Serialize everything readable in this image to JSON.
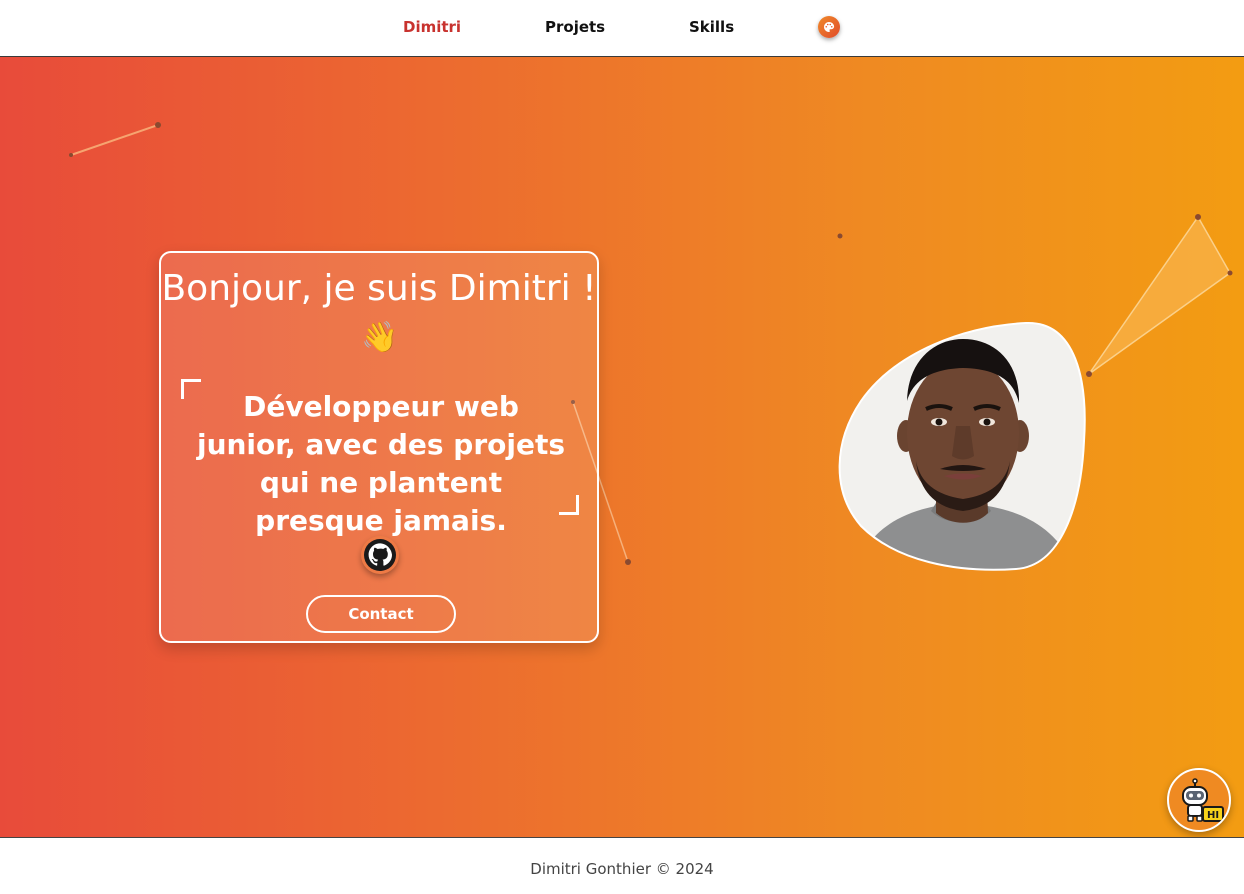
{
  "nav": {
    "home_label": "Dimitri",
    "projects_label": "Projets",
    "skills_label": "Skills",
    "theme_icon": "palette-icon",
    "active_color": "#c8322e"
  },
  "hero": {
    "greeting": "Bonjour, je suis Dimitri !",
    "wave_emoji": "👋",
    "tagline": "Développeur web junior, avec des projets qui ne plantent presque jamais.",
    "github_icon": "github-icon",
    "contact_label": "Contact",
    "photo_alt": "Dimitri",
    "chatbot_badge": "HI",
    "gradient_start": "#e84b3a",
    "gradient_end": "#f39c12"
  },
  "footer": {
    "copyright": "Dimitri Gonthier © 2024"
  }
}
